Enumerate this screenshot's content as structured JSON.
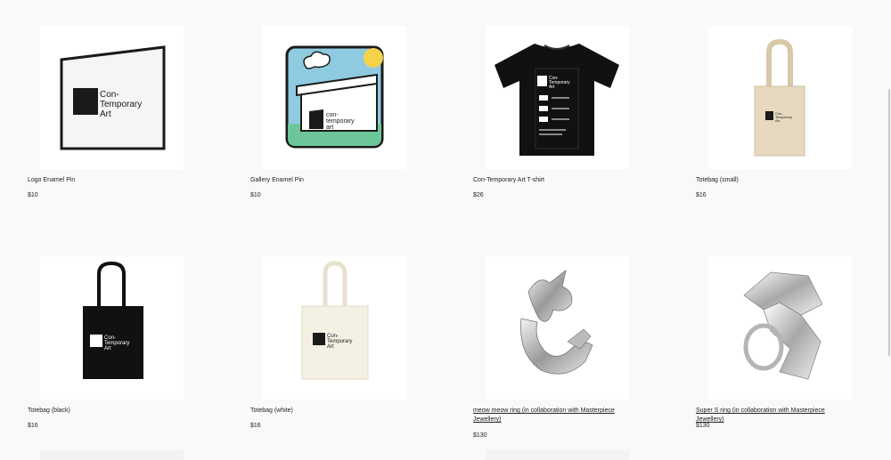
{
  "products": [
    {
      "title": "Logo Enamel Pin",
      "price": "$10",
      "image": "logo-enamel-pin-image"
    },
    {
      "title": "Gallery Enamel Pin",
      "price": "$10",
      "image": "gallery-enamel-pin-image"
    },
    {
      "title": "Con-Temporary Art T-shirt",
      "price": "$26",
      "image": "tshirt-image"
    },
    {
      "title": "Totebag (small)",
      "price": "$16",
      "image": "totebag-small-image"
    },
    {
      "title": "Totebag (black)",
      "price": "$16",
      "image": "totebag-black-image"
    },
    {
      "title": "Totebag (white)",
      "price": "$16",
      "image": "totebag-white-image"
    },
    {
      "title": "meow meow ring (in collaboration with Masterpiece Jewellery)",
      "price": "$130",
      "image": "meow-ring-image"
    },
    {
      "title": "Super S ring (in collaboration with Masterpiece Jewellery)",
      "price": "$130",
      "image": "super-s-ring-image"
    }
  ],
  "logo_text": {
    "line1": "Con-",
    "line2": "Temporary",
    "line3": "Art"
  },
  "logo_text_lower": {
    "line1": "con-",
    "line2": "temporary",
    "line3": "art"
  }
}
